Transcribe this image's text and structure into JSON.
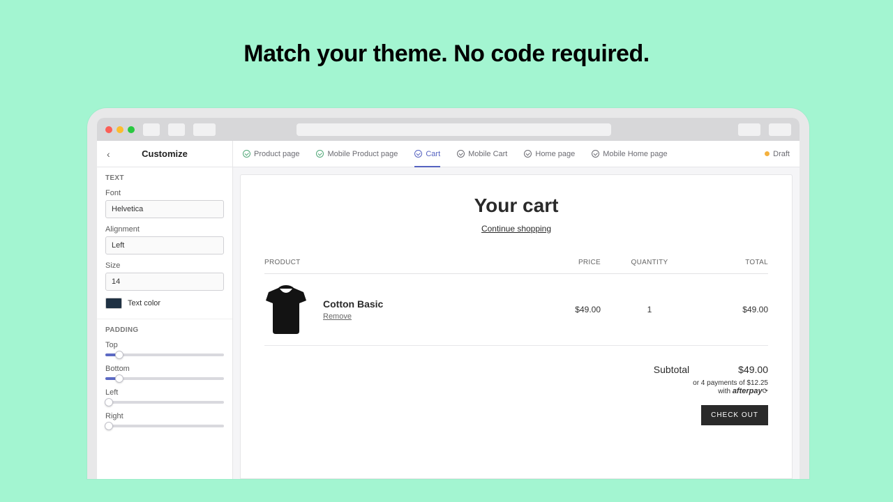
{
  "hero": {
    "title": "Match your theme. No code required."
  },
  "sidebar": {
    "title": "Customize",
    "text_section": {
      "heading": "TEXT",
      "font_label": "Font",
      "font_value": "Helvetica",
      "alignment_label": "Alignment",
      "alignment_value": "Left",
      "size_label": "Size",
      "size_value": "14",
      "text_color_label": "Text color",
      "text_color_value": "#1f3143"
    },
    "padding_section": {
      "heading": "PADDING",
      "items": [
        {
          "label": "Top",
          "value": 12
        },
        {
          "label": "Bottom",
          "value": 12
        },
        {
          "label": "Left",
          "value": 0
        },
        {
          "label": "Right",
          "value": 0
        }
      ]
    }
  },
  "tabs": {
    "items": [
      {
        "label": "Product page",
        "state": "green"
      },
      {
        "label": "Mobile Product page",
        "state": "green"
      },
      {
        "label": "Cart",
        "state": "active"
      },
      {
        "label": "Mobile Cart",
        "state": ""
      },
      {
        "label": "Home page",
        "state": ""
      },
      {
        "label": "Mobile Home page",
        "state": ""
      }
    ],
    "status": "Draft"
  },
  "cart": {
    "title": "Your cart",
    "continue": "Continue shopping",
    "columns": {
      "product": "PRODUCT",
      "price": "PRICE",
      "qty": "QUANTITY",
      "total": "TOTAL"
    },
    "item": {
      "name": "Cotton Basic",
      "remove": "Remove",
      "price": "$49.00",
      "qty": "1",
      "total": "$49.00"
    },
    "subtotal_label": "Subtotal",
    "subtotal_value": "$49.00",
    "afterpay_line1": "or 4 payments of $12.25",
    "afterpay_line2_prefix": "with ",
    "afterpay_brand": "afterpay",
    "checkout": "CHECK OUT"
  }
}
